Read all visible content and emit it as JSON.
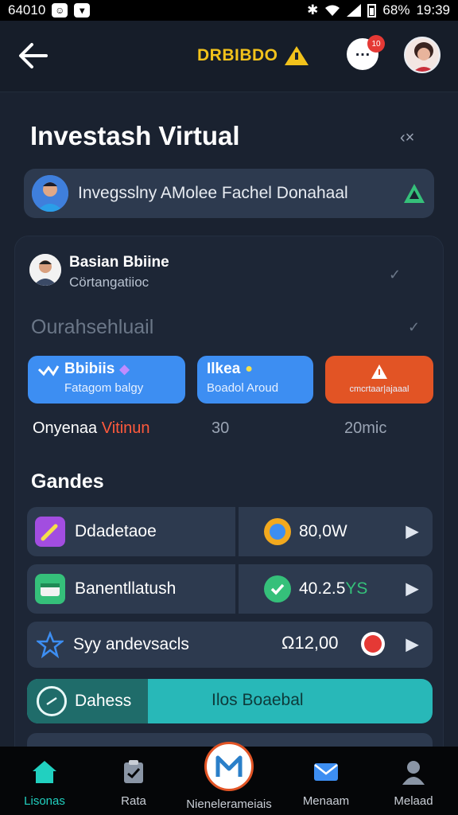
{
  "status_bar": {
    "left_text": "64010",
    "right_text": "68%",
    "time": "19:39"
  },
  "header": {
    "brand": "DRBIBDO",
    "badge": "10"
  },
  "page": {
    "title": "Investash Virtual"
  },
  "banner": {
    "text": "Invegsslny AMolee Fachel Donahaal"
  },
  "user": {
    "name": "Basian Bbiine",
    "subtitle": "Cörtangatiioc"
  },
  "section": {
    "heading": "Ourahsehluail"
  },
  "tiles": [
    {
      "title": "Bbibiis",
      "subtitle": "Fatagom balgy"
    },
    {
      "title": "Ilkea",
      "subtitle": "Boadol Aroud"
    },
    {
      "title": "",
      "subtitle": "cmcrtaar|ajaaal"
    }
  ],
  "stats": {
    "a_prefix": "Onyenaa",
    "a_highlight": "Vitinun",
    "b": "30",
    "c": "20mic"
  },
  "gandes": {
    "heading": "Gandes"
  },
  "rows": [
    {
      "label": "Ddadetaoe",
      "value": "80,0W",
      "value_highlight": ""
    },
    {
      "label": "Banentllatush",
      "value": "40.2.5",
      "value_highlight": "YS"
    },
    {
      "label": "Syy andevsacls",
      "value": "12,00",
      "value_highlight": ""
    }
  ],
  "teal_row": {
    "left": "Dahess",
    "right": "Ilos Boaebal"
  },
  "nav": [
    {
      "label": "Lisonas",
      "icon": "home-icon",
      "active": true
    },
    {
      "label": "Rata",
      "icon": "clipboard-icon",
      "active": false
    },
    {
      "label": "Nienelerameiais",
      "icon": "m-logo-icon",
      "active": false
    },
    {
      "label": "Menaam",
      "icon": "mail-icon",
      "active": false
    },
    {
      "label": "Melaad",
      "icon": "person-icon",
      "active": false
    }
  ],
  "colors": {
    "background": "#1a2230",
    "card": "#2d3a4f",
    "accent_blue": "#3d8ef2",
    "accent_orange": "#e25425",
    "accent_teal": "#28b8b8",
    "brand_yellow": "#f2c21b"
  }
}
